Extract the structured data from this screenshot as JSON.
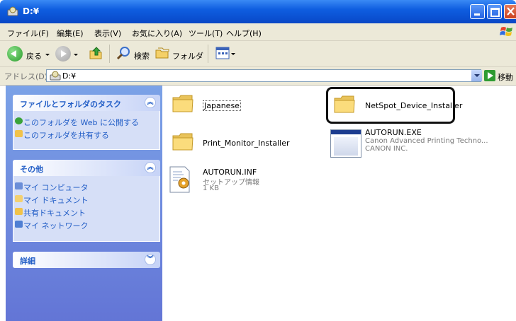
{
  "window": {
    "title": "D:¥"
  },
  "menu": [
    "ファイル(F)",
    "編集(E)",
    "表示(V)",
    "お気に入り(A)",
    "ツール(T)",
    "ヘルプ(H)"
  ],
  "toolbar": {
    "back_label": "戻る",
    "search_label": "検索",
    "folders_label": "フォルダ"
  },
  "address": {
    "label": "アドレス(D)",
    "value": "D:¥",
    "go_label": "移動"
  },
  "taskpane": {
    "tasks": {
      "title": "ファイルとフォルダのタスク",
      "links": [
        "このフォルダを Web に公開する",
        "このフォルダを共有する"
      ]
    },
    "other": {
      "title": "その他",
      "links": [
        "マイ コンピュータ",
        "マイ ドキュメント",
        "共有ドキュメント",
        "マイ ネットワーク"
      ]
    },
    "details": {
      "title": "詳細"
    }
  },
  "files": [
    {
      "name": "Japanese",
      "type": "folder"
    },
    {
      "name": "NetSpot_Device_Installer",
      "type": "folder"
    },
    {
      "name": "Print_Monitor_Installer",
      "type": "folder"
    },
    {
      "name": "AUTORUN.EXE",
      "type": "exe",
      "line2": "Canon Advanced Printing Techno...",
      "line3": "CANON INC."
    },
    {
      "name": "AUTORUN.INF",
      "type": "inf",
      "line2": "セットアップ情報",
      "line3": "1 KB"
    }
  ],
  "colors": {
    "titlebar": "#0a4fd0",
    "taskpane": "#7ba2e7",
    "link": "#215dc6",
    "menubar": "#ece9d8"
  }
}
